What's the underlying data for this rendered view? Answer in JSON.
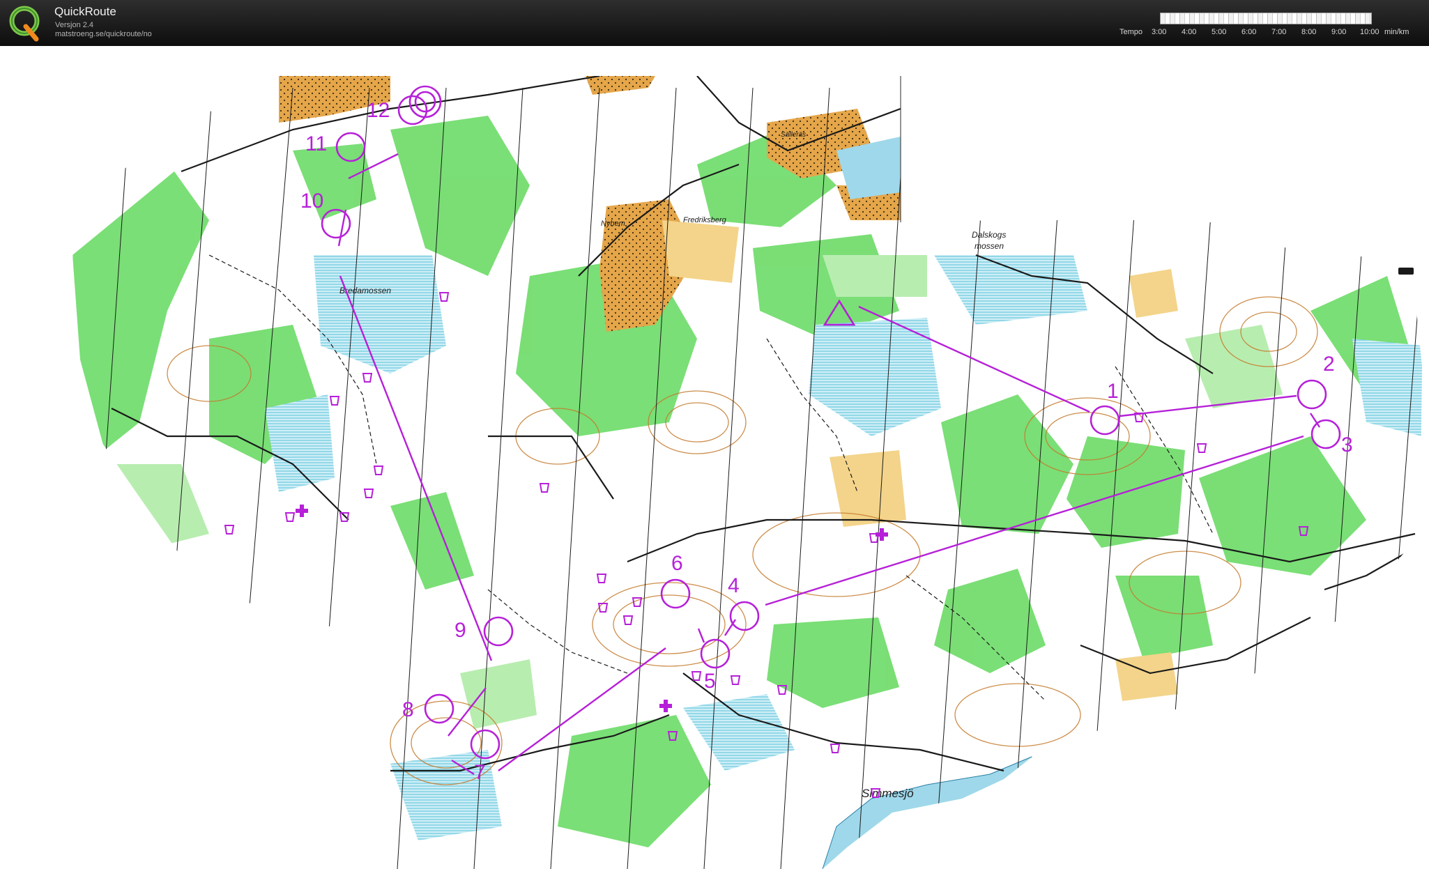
{
  "app": {
    "title": "QuickRoute",
    "version": "Versjon 2.4",
    "url": "matstroeng.se/quickroute/no"
  },
  "icons": {
    "logo": "quickroute-q-logo",
    "collapse": "panel-collapse-tab"
  },
  "tempo": {
    "label": "Tempo",
    "ticks": [
      "3:00",
      "4:00",
      "5:00",
      "6:00",
      "7:00",
      "8:00",
      "9:00",
      "10:00"
    ],
    "unit": "min/km"
  },
  "course": {
    "color": "#b620d8",
    "controls": [
      "1",
      "2",
      "3",
      "4",
      "5",
      "6",
      "7",
      "8",
      "9",
      "10",
      "11",
      "12"
    ]
  },
  "map_labels": {
    "bredamossen": "Bredamossen",
    "dalskogs_1": "Dalskogs",
    "dalskogs_2": "mossen",
    "nyhem": "Nyhem",
    "fredriksberg": "Fredriksberg",
    "salleras": "Sälleräs",
    "simmesjo": "Simmesjö"
  },
  "colors": {
    "forest_open": "#ffffff",
    "forest_green": "#6fdc6a",
    "open_yellow": "#e8b86a",
    "water_blue": "#a6ddee",
    "marsh_blue": "#6dcbe0",
    "contour_brown": "#c47a2c",
    "settlement_orange": "#e5a64a"
  }
}
